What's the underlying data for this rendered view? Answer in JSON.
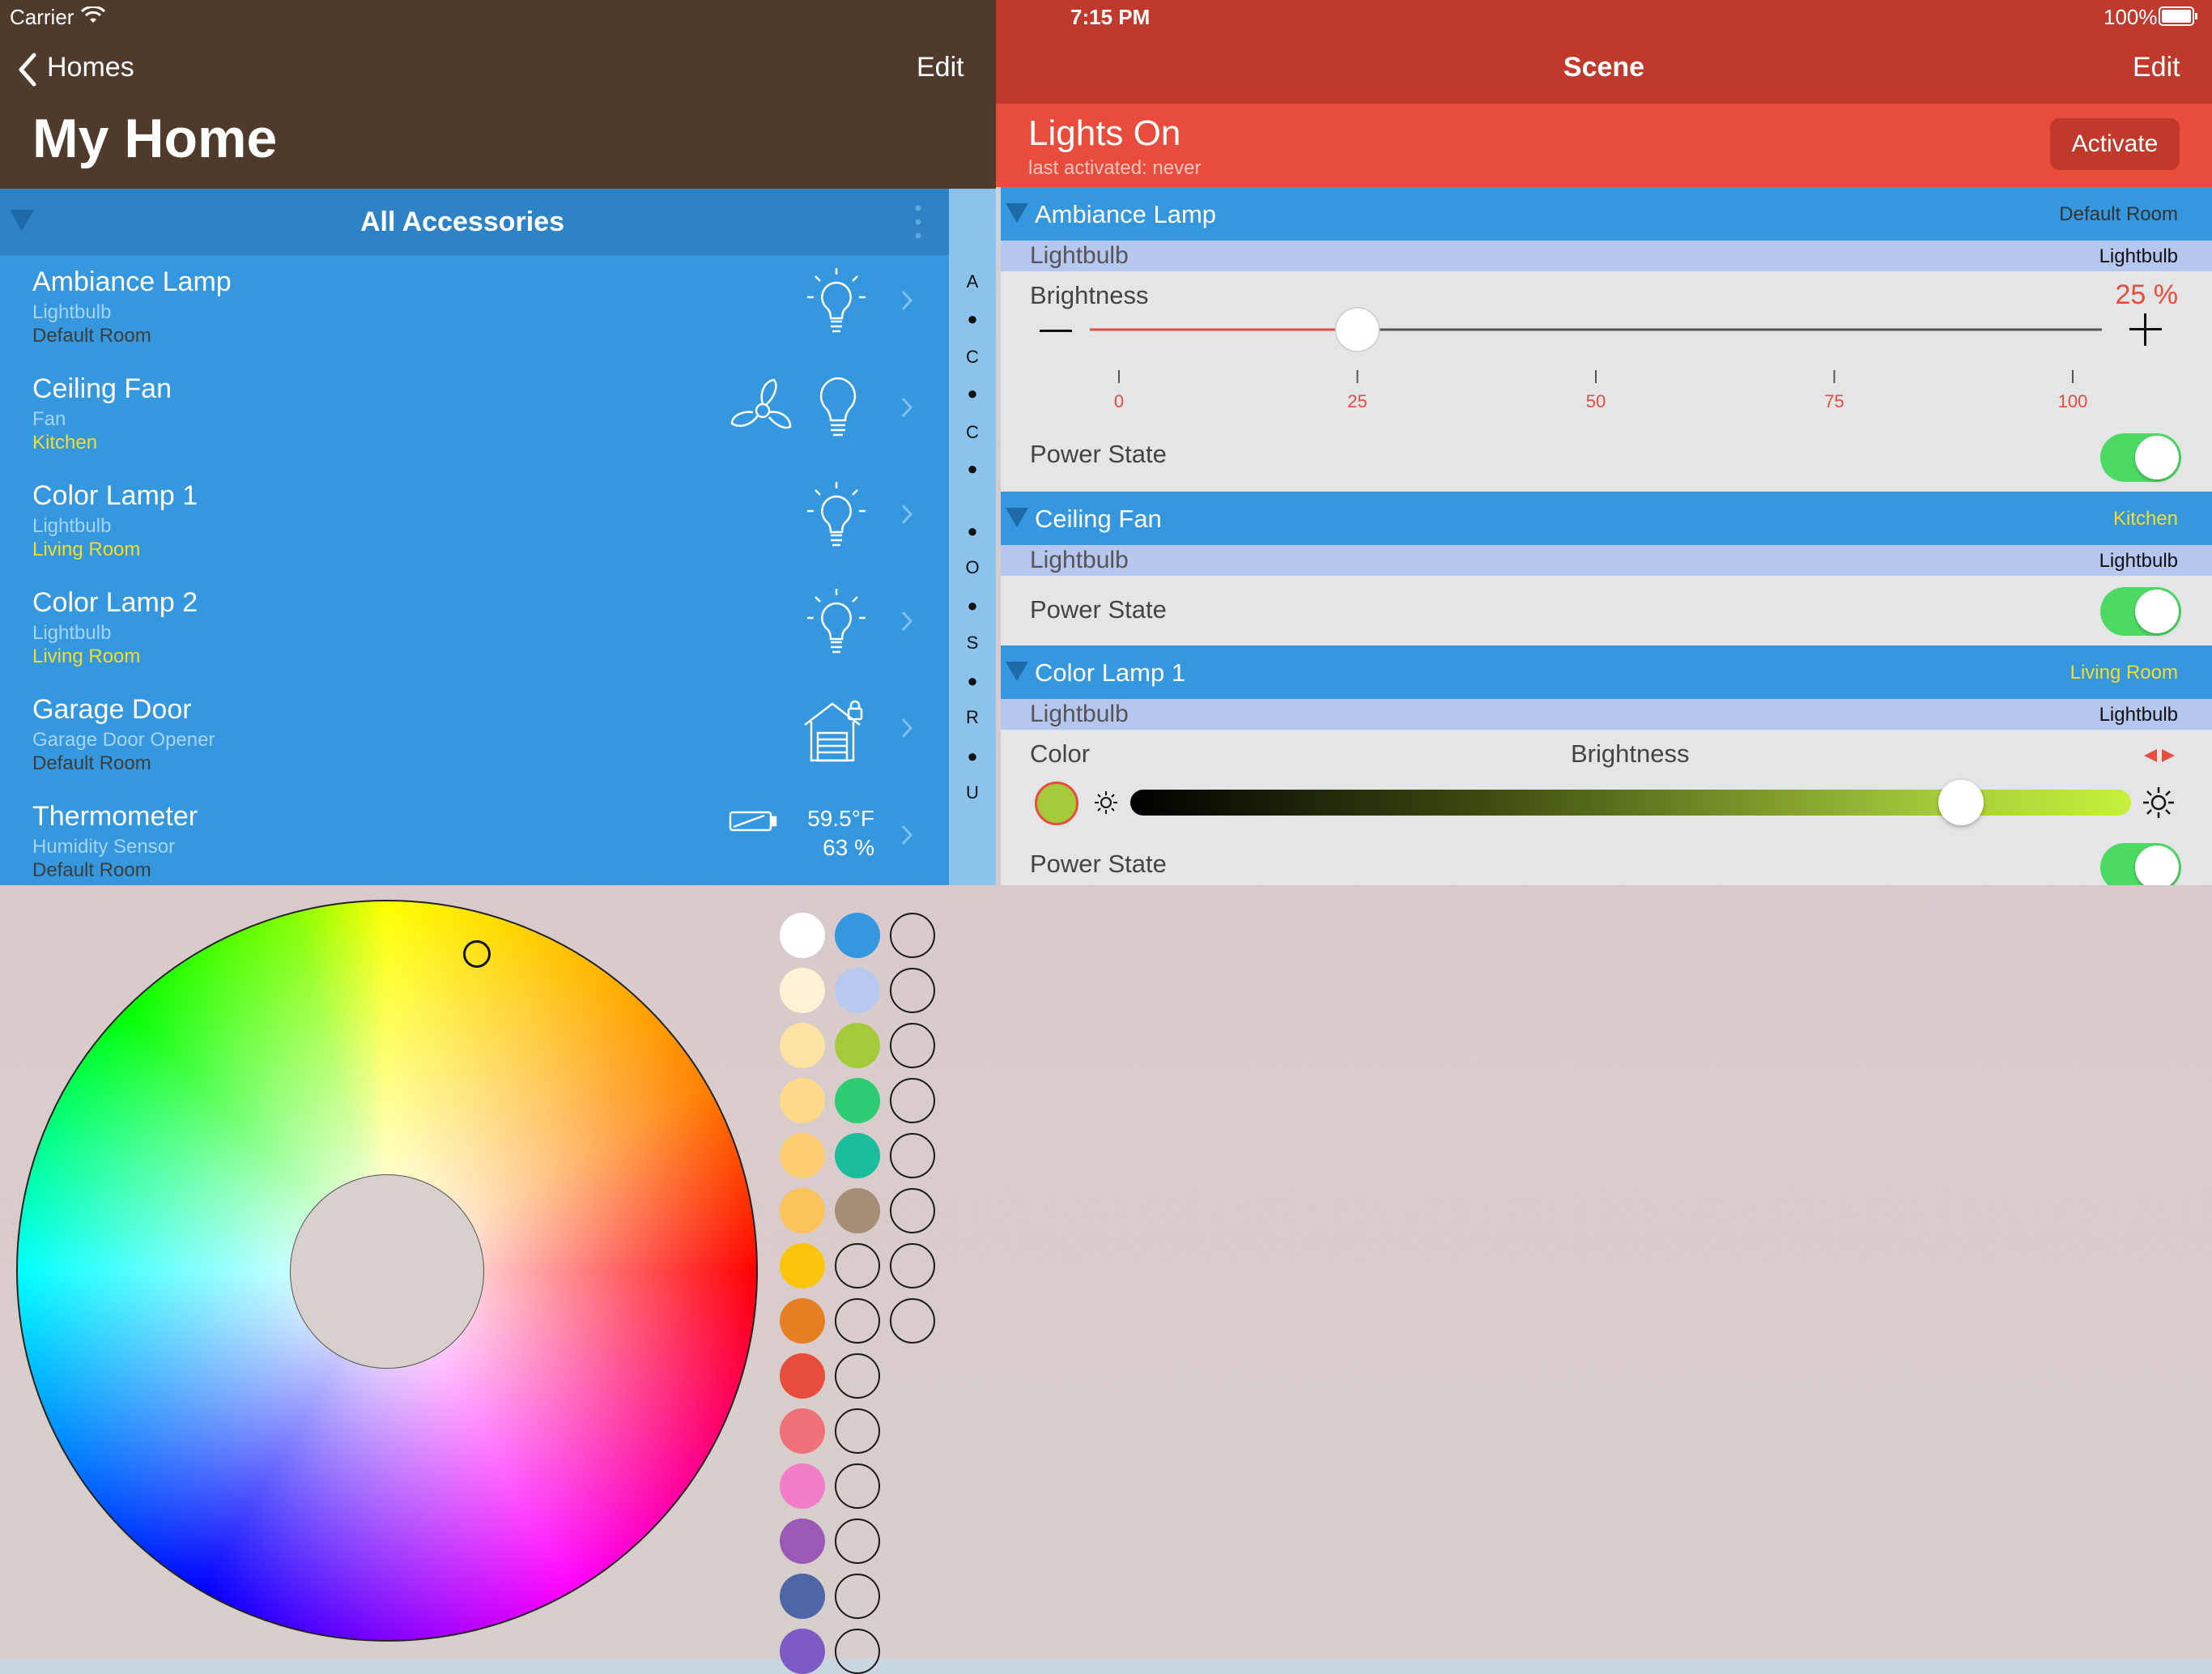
{
  "status": {
    "carrier": "Carrier",
    "time": "7:15 PM",
    "battery": "100%"
  },
  "left_nav": {
    "back_label": "Homes",
    "edit_label": "Edit",
    "title": "My Home"
  },
  "accessories_header": {
    "title": "All Accessories"
  },
  "accessories": [
    {
      "name": "Ambiance Lamp",
      "type": "Lightbulb",
      "room": "Default Room",
      "icons": [
        "lightbulb-icon"
      ]
    },
    {
      "name": "Ceiling Fan",
      "type": "Fan",
      "room": "Kitchen",
      "icons": [
        "fan-icon",
        "lightbulb-icon"
      ]
    },
    {
      "name": "Color Lamp 1",
      "type": "Lightbulb",
      "room": "Living Room",
      "icons": [
        "lightbulb-icon"
      ]
    },
    {
      "name": "Color Lamp 2",
      "type": "Lightbulb",
      "room": "Living Room",
      "icons": [
        "lightbulb-icon"
      ]
    },
    {
      "name": "Garage Door",
      "type": "Garage Door Opener",
      "room": "Default Room",
      "icons": [
        "garage-icon"
      ]
    },
    {
      "name": "Thermometer",
      "type": "Humidity Sensor",
      "room": "Default Room",
      "icons": [
        "battery-icon"
      ],
      "temperature": "59.5°F",
      "humidity": "63 %"
    }
  ],
  "index_letters": [
    "A",
    "C",
    "C",
    "O",
    "S",
    "R",
    "U"
  ],
  "scene": {
    "nav_title": "Scene",
    "edit_label": "Edit",
    "name": "Lights On",
    "last_activated": "last activated: never",
    "activate_label": "Activate",
    "sections": [
      {
        "name": "Ambiance Lamp",
        "room": "Default Room",
        "service": "Lightbulb",
        "service_type": "Lightbulb",
        "brightness_label": "Brightness",
        "brightness_value": "25 %",
        "brightness": 25,
        "ticks": [
          "0",
          "25",
          "50",
          "75",
          "100"
        ],
        "power_label": "Power State",
        "power_on": true
      },
      {
        "name": "Ceiling Fan",
        "room": "Kitchen",
        "service": "Lightbulb",
        "service_type": "Lightbulb",
        "power_label": "Power State",
        "power_on": true
      },
      {
        "name": "Color Lamp 1",
        "room": "Living Room",
        "service": "Lightbulb",
        "service_type": "Lightbulb",
        "color_label": "Color",
        "brightness_label": "Brightness",
        "brightness": 83,
        "power_label": "Power State",
        "power_on": true
      }
    ]
  },
  "colors": {
    "accent_blue": "#3597dd",
    "nav_brown": "#4f3a2c",
    "scene_red": "#e74c3c",
    "switch_green": "#4cd964",
    "selected_color": "#a4c93a"
  },
  "palette": {
    "column1": [
      "#ffffff",
      "#fdf3d4",
      "#fde2a4",
      "#fdd98a",
      "#fdcd72",
      "#fdc35b",
      "#fbc50e",
      "#e67e22",
      "#e74c3c",
      "#f07178",
      "#f37ec8",
      "#9b59b6",
      "#4e66a5",
      "#7e5bc4"
    ],
    "column2": [
      "#3597dd",
      "#b8c9ef",
      "#a4c93a",
      "#2ecc71",
      "#1abc9c",
      "#a58d76",
      null,
      null,
      null,
      null,
      null,
      null,
      null,
      null
    ],
    "column3": [
      null,
      null,
      null,
      null,
      null,
      null,
      null,
      null
    ]
  }
}
